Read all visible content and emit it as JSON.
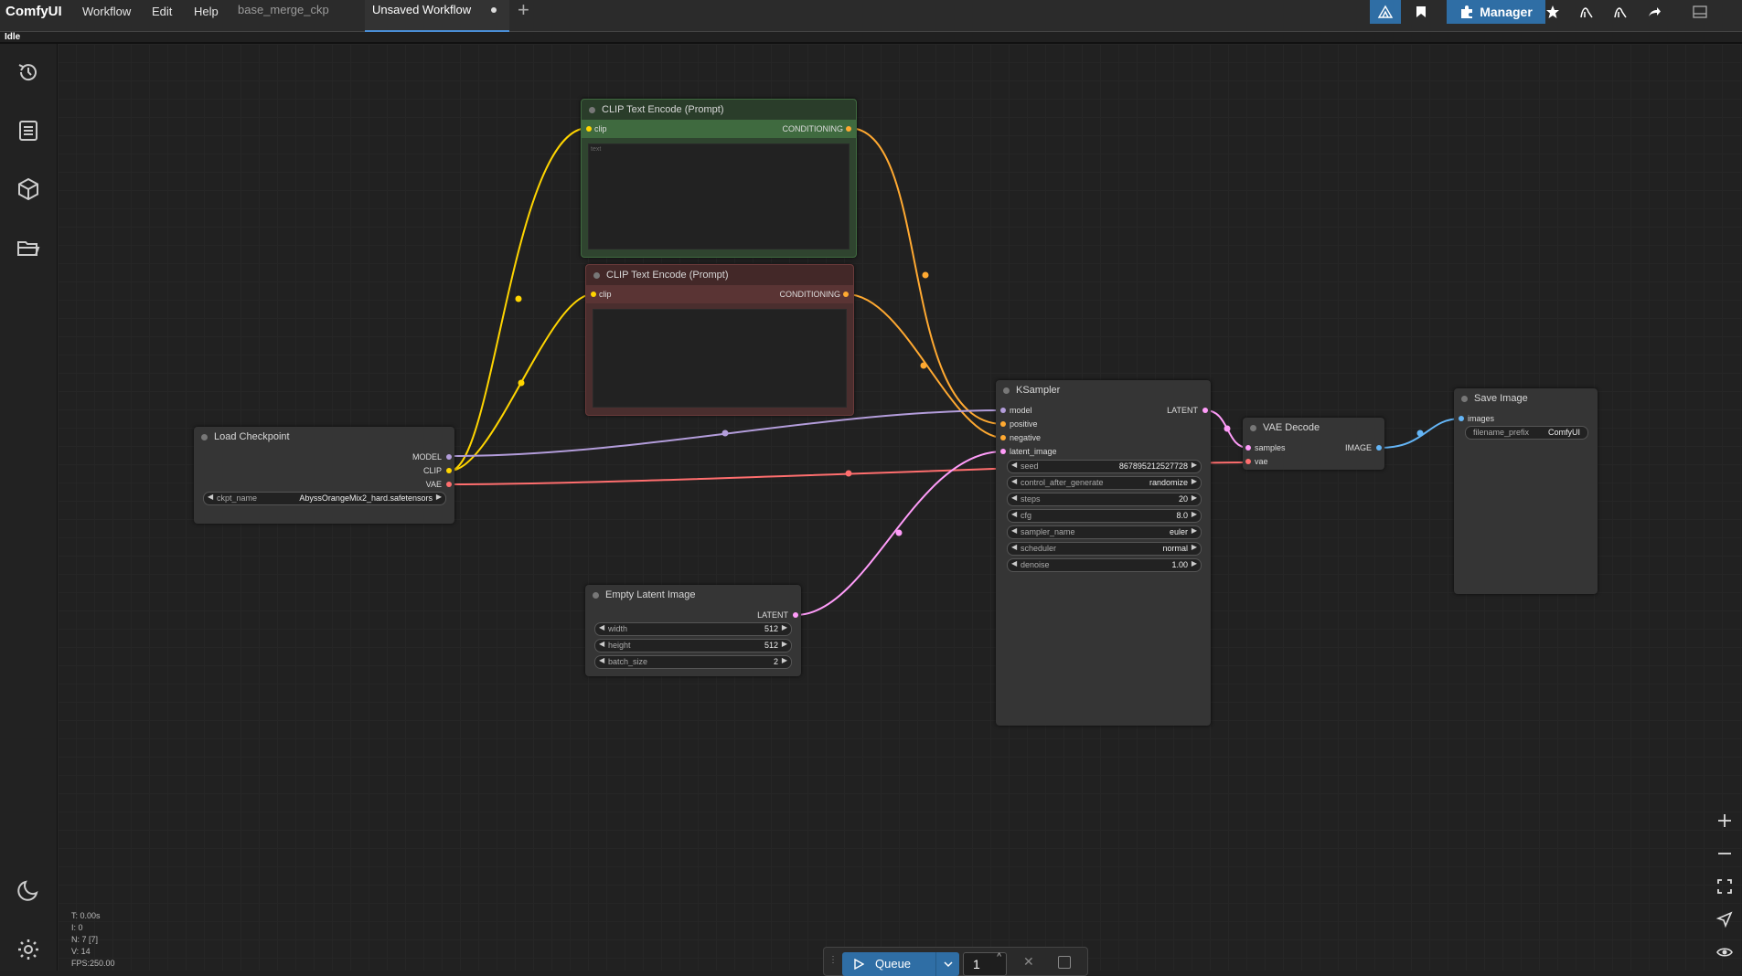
{
  "app": {
    "name": "ComfyUI",
    "status": "Idle"
  },
  "menu": [
    "Workflow",
    "Edit",
    "Help"
  ],
  "tabs": [
    {
      "label": "base_merge_ckp",
      "active": false,
      "unsaved": false
    },
    {
      "label": "Unsaved Workflow",
      "active": true,
      "unsaved": true
    }
  ],
  "toolbar": {
    "manager_label": "Manager"
  },
  "nodes": {
    "clip_pos": {
      "title": "CLIP Text Encode (Prompt)",
      "input": "clip",
      "output": "CONDITIONING",
      "text_placeholder": "text"
    },
    "clip_neg": {
      "title": "CLIP Text Encode (Prompt)",
      "input": "clip",
      "output": "CONDITIONING"
    },
    "load_ckpt": {
      "title": "Load Checkpoint",
      "outputs": [
        "MODEL",
        "CLIP",
        "VAE"
      ],
      "widgets": [
        {
          "label": "ckpt_name",
          "value": "AbyssOrangeMix2_hard.safetensors"
        }
      ]
    },
    "empty_latent": {
      "title": "Empty Latent Image",
      "output": "LATENT",
      "widgets": [
        {
          "label": "width",
          "value": "512"
        },
        {
          "label": "height",
          "value": "512"
        },
        {
          "label": "batch_size",
          "value": "2"
        }
      ]
    },
    "ksampler": {
      "title": "KSampler",
      "inputs": [
        "model",
        "positive",
        "negative",
        "latent_image"
      ],
      "output": "LATENT",
      "widgets": [
        {
          "label": "seed",
          "value": "867895212527728"
        },
        {
          "label": "control_after_generate",
          "value": "randomize"
        },
        {
          "label": "steps",
          "value": "20"
        },
        {
          "label": "cfg",
          "value": "8.0"
        },
        {
          "label": "sampler_name",
          "value": "euler"
        },
        {
          "label": "scheduler",
          "value": "normal"
        },
        {
          "label": "denoise",
          "value": "1.00"
        }
      ]
    },
    "vae_decode": {
      "title": "VAE Decode",
      "inputs": [
        "samples",
        "vae"
      ],
      "output": "IMAGE"
    },
    "save_image": {
      "title": "Save Image",
      "input": "images",
      "widgets": [
        {
          "label": "filename_prefix",
          "value": "ComfyUI"
        }
      ]
    }
  },
  "stats": {
    "t": "T: 0.00s",
    "i": "I: 0",
    "n": "N: 7 [7]",
    "v": "V: 14",
    "fps": "FPS:250.00"
  },
  "queue": {
    "label": "Queue",
    "count": "1"
  },
  "colors": {
    "clip_link": "#ffd500",
    "conditioning_link": "#ffa931",
    "model_link": "#b39ddb",
    "vae_link": "#ff6e6e",
    "latent_link": "#ff9cf9",
    "image_link": "#64b5f6",
    "accent": "#2f6ea5"
  }
}
